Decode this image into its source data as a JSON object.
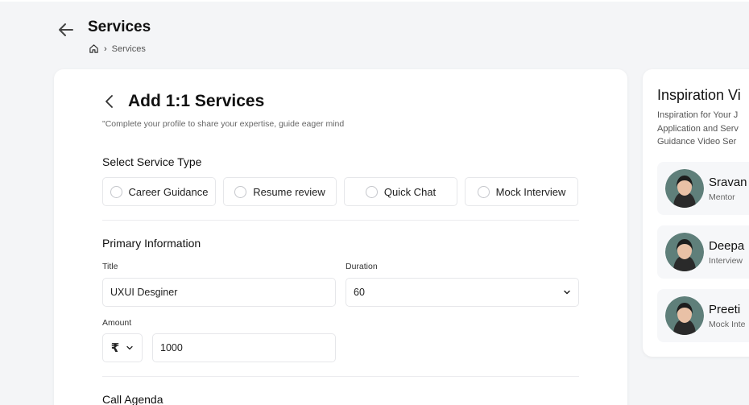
{
  "header": {
    "title": "Services",
    "breadcrumb": {
      "current": "Services"
    }
  },
  "form": {
    "title": "Add 1:1 Services",
    "subtitle": "\"Complete your profile to share your expertise, guide eager mind",
    "service_type": {
      "label": "Select Service Type",
      "options": [
        "Career Guidance",
        "Resume review",
        "Quick Chat",
        "Mock Interview"
      ]
    },
    "primary": {
      "label": "Primary Information",
      "title_label": "Title",
      "title_value": "UXUI Desginer",
      "duration_label": "Duration",
      "duration_value": "60",
      "amount_label": "Amount",
      "currency_symbol": "₹",
      "amount_value": "1000"
    },
    "agenda_label": "Call Agenda"
  },
  "inspiration": {
    "title": "Inspiration Vi",
    "desc_lines": [
      "Inspiration for Your J",
      "Application and Serv",
      "Guidance Video Ser"
    ],
    "people": [
      {
        "name": "Sravan",
        "role": "Mentor"
      },
      {
        "name": "Deepa",
        "role": "Interview"
      },
      {
        "name": "Preeti",
        "role": "Mock Inte"
      }
    ]
  },
  "icons": {
    "back": "arrow-left-icon",
    "home": "home-icon",
    "chevron": "chevron-down-icon"
  }
}
